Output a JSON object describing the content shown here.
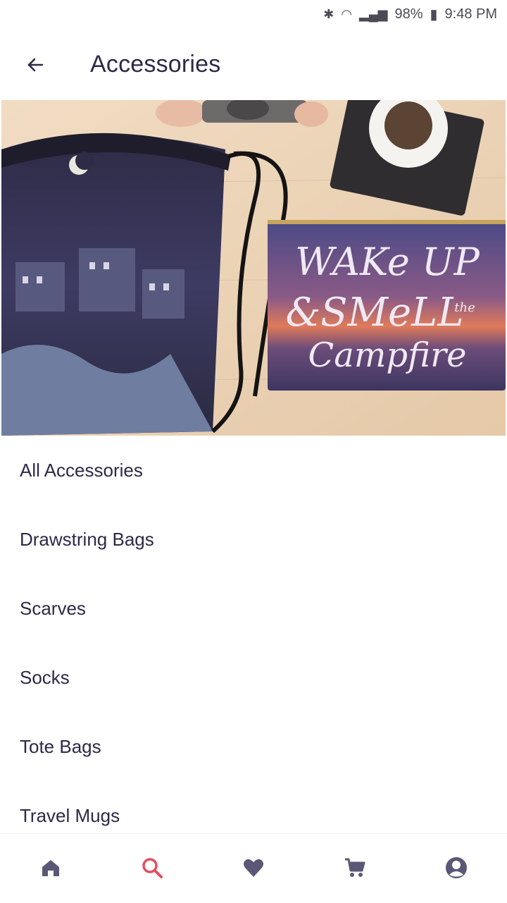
{
  "status_bar": {
    "battery": "98%",
    "time": "9:48 PM"
  },
  "header": {
    "title": "Accessories",
    "back_icon": "arrow-left-icon"
  },
  "hero": {
    "bag_text_line1": "WAKe UP",
    "bag_text_line2": "&SMeLL",
    "bag_text_line2_small": "the",
    "bag_text_line3": "Campfire"
  },
  "categories": [
    {
      "label": "All Accessories"
    },
    {
      "label": "Drawstring Bags"
    },
    {
      "label": "Scarves"
    },
    {
      "label": "Socks"
    },
    {
      "label": "Tote Bags"
    },
    {
      "label": "Travel Mugs"
    }
  ],
  "bottom_nav": {
    "items": [
      {
        "icon": "home-icon"
      },
      {
        "icon": "search-icon"
      },
      {
        "icon": "heart-icon"
      },
      {
        "icon": "cart-icon"
      },
      {
        "icon": "account-icon"
      }
    ],
    "active_color": "#e0505e",
    "inactive_color": "#5a5876"
  }
}
